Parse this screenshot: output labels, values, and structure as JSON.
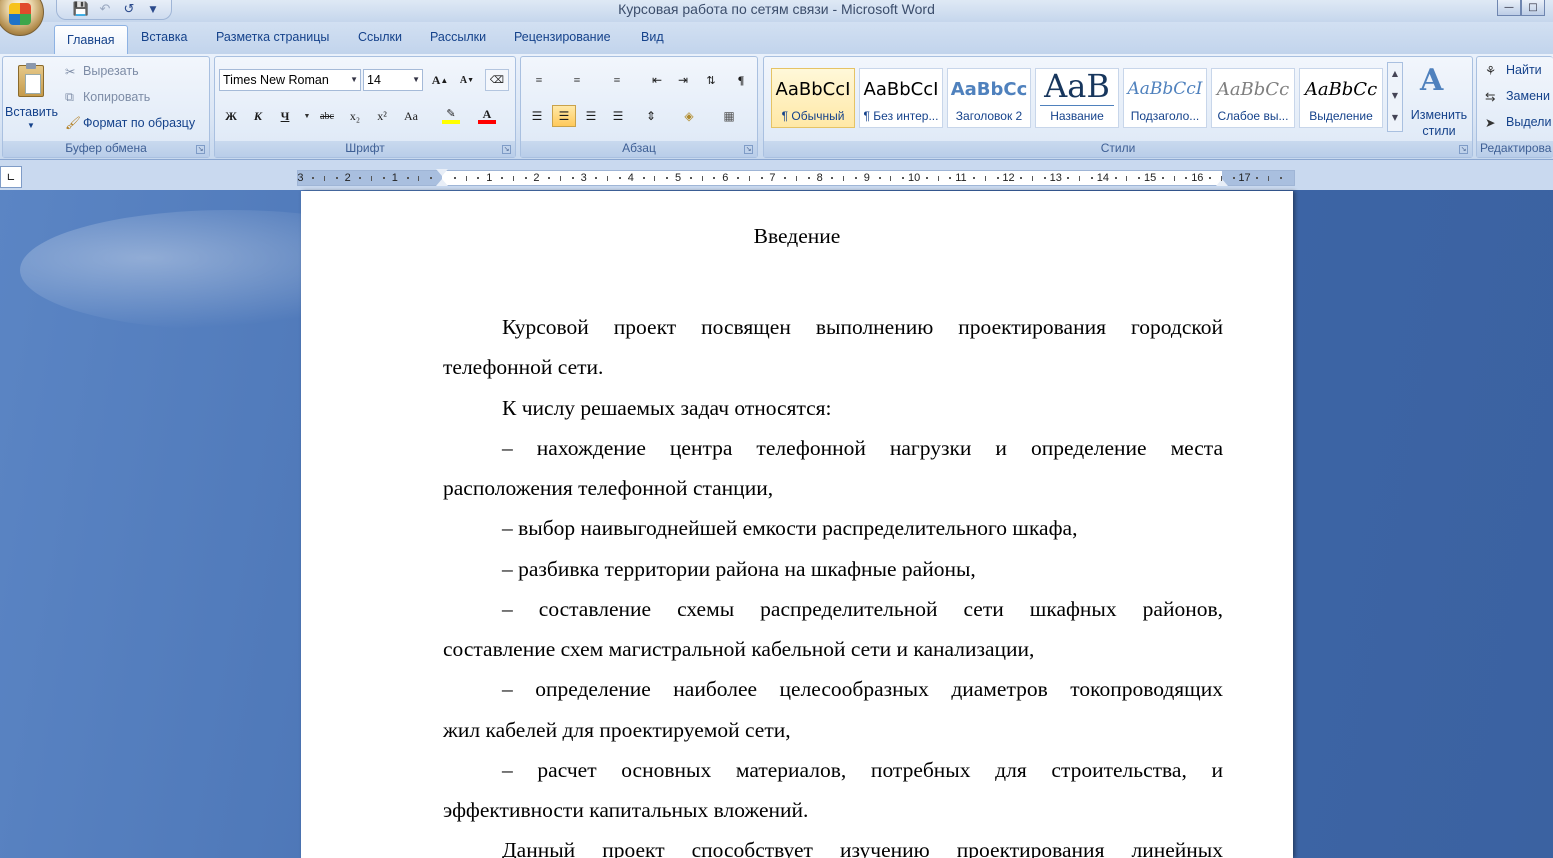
{
  "window": {
    "title": "Курсовая работа по сетям связи - Microsoft Word"
  },
  "tabs": [
    "Главная",
    "Вставка",
    "Разметка страницы",
    "Ссылки",
    "Рассылки",
    "Рецензирование",
    "Вид"
  ],
  "clipboard": {
    "paste": "Вставить",
    "cut": "Вырезать",
    "copy": "Копировать",
    "format_painter": "Формат по образцу",
    "label": "Буфер обмена"
  },
  "font": {
    "name": "Times New Roman",
    "size": "14",
    "label": "Шрифт",
    "bold": "Ж",
    "italic": "К",
    "underline": "Ч",
    "strike": "abc",
    "subscript": "x₂",
    "superscript": "x²",
    "case": "Aa",
    "grow": "A",
    "shrink": "A"
  },
  "paragraph": {
    "label": "Абзац"
  },
  "styles": {
    "label": "Стили",
    "items": [
      {
        "preview": "AaBbCcI",
        "name": "¶ Обычный"
      },
      {
        "preview": "AaBbCcI",
        "name": "¶ Без интер..."
      },
      {
        "preview": "AaBbCc",
        "name": "Заголовок 2"
      },
      {
        "preview": "AaB",
        "name": "Название"
      },
      {
        "preview": "AaBbCcI",
        "name": "Подзаголо..."
      },
      {
        "preview": "AaBbCc",
        "name": "Слабое вы..."
      },
      {
        "preview": "AaBbCc",
        "name": "Выделение"
      }
    ],
    "change_styles": "Изменить стили"
  },
  "editing": {
    "find": "Найти",
    "replace": "Замени",
    "select": "Выдели",
    "label": "Редактирова"
  },
  "ruler": {
    "left_numbers": [
      "3",
      "2",
      "1"
    ],
    "right_numbers": [
      "1",
      "2",
      "3",
      "4",
      "5",
      "6",
      "7",
      "8",
      "9",
      "10",
      "11",
      "12",
      "13",
      "14",
      "15",
      "16",
      "17"
    ]
  },
  "document": {
    "title": "Введение",
    "lines": [
      "Курсовой проект посвящен выполнению проектирования городской",
      "телефонной сети.",
      "К числу решаемых задач относятся:",
      "– нахождение центра телефонной нагрузки и определение места",
      "расположения телефонной станции,",
      "– выбор наивыгоднейшей емкости распределительного шкафа,",
      "– разбивка территории района на шкафные районы,",
      "– составление схемы распределительной сети шкафных районов,",
      "составление схем магистральной кабельной сети и канализации,",
      "– определение наиболее целесообразных диаметров токопроводящих",
      "жил кабелей для проектируемой сети,",
      "– расчет основных материалов, потребных для строительства, и",
      "эффективности капитальных вложений.",
      "Данный проект способствует изучению проектирования линейных"
    ]
  },
  "colors": {
    "highlight": "#ffff00",
    "font_color": "#ff0000"
  }
}
